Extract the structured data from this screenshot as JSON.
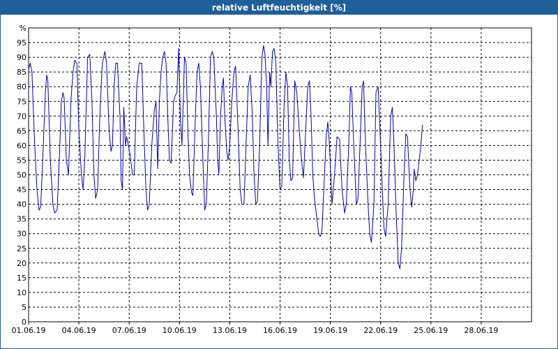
{
  "window": {
    "title": "relative Luftfeuchtigkeit [%]"
  },
  "chart_data": {
    "type": "line",
    "title": "relative Luftfeuchtigkeit [%]",
    "ylabel": "%",
    "xlabel": "",
    "ylim": [
      0,
      100
    ],
    "y_ticks": [
      0,
      5,
      10,
      15,
      20,
      25,
      30,
      35,
      40,
      45,
      50,
      55,
      60,
      65,
      70,
      75,
      80,
      85,
      90,
      95
    ],
    "x_tick_labels": [
      "01.06.19",
      "04.06.19",
      "07.06.19",
      "10.06.19",
      "13.06.19",
      "16.06.19",
      "19.06.19",
      "22.06.19",
      "25.06.19",
      "28.06.19"
    ],
    "xlim_days": [
      1,
      31
    ],
    "grid": true,
    "line_color": "#0000b8",
    "series": [
      {
        "points": [
          [
            1.0,
            86
          ],
          [
            1.1,
            88
          ],
          [
            1.2,
            85
          ],
          [
            1.35,
            62
          ],
          [
            1.5,
            45
          ],
          [
            1.62,
            38
          ],
          [
            1.72,
            39
          ],
          [
            1.88,
            60
          ],
          [
            2.0,
            78
          ],
          [
            2.08,
            84
          ],
          [
            2.15,
            82
          ],
          [
            2.3,
            55
          ],
          [
            2.45,
            40
          ],
          [
            2.55,
            37
          ],
          [
            2.7,
            38
          ],
          [
            2.85,
            58
          ],
          [
            2.95,
            75
          ],
          [
            3.05,
            78
          ],
          [
            3.12,
            76
          ],
          [
            3.25,
            55
          ],
          [
            3.38,
            50
          ],
          [
            3.52,
            75
          ],
          [
            3.65,
            85
          ],
          [
            3.75,
            89
          ],
          [
            3.88,
            88
          ],
          [
            4.0,
            65
          ],
          [
            4.15,
            50
          ],
          [
            4.25,
            45
          ],
          [
            4.35,
            55
          ],
          [
            4.52,
            90
          ],
          [
            4.65,
            91
          ],
          [
            4.78,
            75
          ],
          [
            4.9,
            50
          ],
          [
            5.0,
            42
          ],
          [
            5.12,
            45
          ],
          [
            5.25,
            70
          ],
          [
            5.4,
            88
          ],
          [
            5.55,
            92
          ],
          [
            5.65,
            88
          ],
          [
            5.8,
            65
          ],
          [
            5.92,
            58
          ],
          [
            6.0,
            60
          ],
          [
            6.1,
            80
          ],
          [
            6.2,
            88
          ],
          [
            6.3,
            88
          ],
          [
            6.45,
            70
          ],
          [
            6.52,
            48
          ],
          [
            6.6,
            45
          ],
          [
            6.68,
            73
          ],
          [
            6.78,
            60
          ],
          [
            6.85,
            63
          ],
          [
            6.95,
            60
          ],
          [
            7.05,
            57
          ],
          [
            7.2,
            50
          ],
          [
            7.3,
            50
          ],
          [
            7.45,
            80
          ],
          [
            7.6,
            88
          ],
          [
            7.75,
            88
          ],
          [
            7.88,
            65
          ],
          [
            8.0,
            45
          ],
          [
            8.1,
            38
          ],
          [
            8.2,
            40
          ],
          [
            8.35,
            60
          ],
          [
            8.5,
            72
          ],
          [
            8.6,
            75
          ],
          [
            8.7,
            52
          ],
          [
            8.8,
            75
          ],
          [
            8.9,
            85
          ],
          [
            9.0,
            90
          ],
          [
            9.1,
            92
          ],
          [
            9.2,
            88
          ],
          [
            9.3,
            70
          ],
          [
            9.4,
            55
          ],
          [
            9.5,
            54
          ],
          [
            9.65,
            75
          ],
          [
            9.75,
            77
          ],
          [
            9.85,
            78
          ],
          [
            9.95,
            93
          ],
          [
            10.05,
            70
          ],
          [
            10.15,
            60
          ],
          [
            10.3,
            90
          ],
          [
            10.4,
            88
          ],
          [
            10.5,
            65
          ],
          [
            10.6,
            50
          ],
          [
            10.72,
            44
          ],
          [
            10.8,
            43
          ],
          [
            10.95,
            70
          ],
          [
            11.05,
            85
          ],
          [
            11.15,
            88
          ],
          [
            11.25,
            80
          ],
          [
            11.4,
            55
          ],
          [
            11.5,
            38
          ],
          [
            11.6,
            40
          ],
          [
            11.72,
            60
          ],
          [
            11.85,
            90
          ],
          [
            11.95,
            92
          ],
          [
            12.05,
            90
          ],
          [
            12.2,
            70
          ],
          [
            12.28,
            55
          ],
          [
            12.35,
            50
          ],
          [
            12.45,
            70
          ],
          [
            12.55,
            80
          ],
          [
            12.62,
            83
          ],
          [
            12.7,
            70
          ],
          [
            12.82,
            58
          ],
          [
            12.9,
            55
          ],
          [
            13.0,
            60
          ],
          [
            13.12,
            75
          ],
          [
            13.25,
            85
          ],
          [
            13.35,
            87
          ],
          [
            13.5,
            65
          ],
          [
            13.62,
            45
          ],
          [
            13.72,
            40
          ],
          [
            13.85,
            40
          ],
          [
            13.97,
            60
          ],
          [
            14.1,
            80
          ],
          [
            14.22,
            84
          ],
          [
            14.35,
            70
          ],
          [
            14.45,
            50
          ],
          [
            14.55,
            40
          ],
          [
            14.65,
            41
          ],
          [
            14.78,
            60
          ],
          [
            14.92,
            90
          ],
          [
            15.02,
            94
          ],
          [
            15.1,
            91
          ],
          [
            15.2,
            80
          ],
          [
            15.28,
            60
          ],
          [
            15.38,
            85
          ],
          [
            15.45,
            80
          ],
          [
            15.55,
            92
          ],
          [
            15.65,
            93
          ],
          [
            15.75,
            88
          ],
          [
            15.88,
            60
          ],
          [
            16.0,
            45
          ],
          [
            16.1,
            46
          ],
          [
            16.25,
            75
          ],
          [
            16.35,
            85
          ],
          [
            16.45,
            80
          ],
          [
            16.55,
            55
          ],
          [
            16.65,
            48
          ],
          [
            16.75,
            49
          ],
          [
            16.88,
            82
          ],
          [
            17.0,
            78
          ],
          [
            17.15,
            65
          ],
          [
            17.28,
            55
          ],
          [
            17.4,
            49
          ],
          [
            17.55,
            68
          ],
          [
            17.65,
            80
          ],
          [
            17.75,
            82
          ],
          [
            17.85,
            70
          ],
          [
            17.95,
            50
          ],
          [
            18.05,
            42
          ],
          [
            18.2,
            35
          ],
          [
            18.3,
            30
          ],
          [
            18.4,
            29
          ],
          [
            18.5,
            31
          ],
          [
            18.65,
            50
          ],
          [
            18.75,
            63
          ],
          [
            18.85,
            68
          ],
          [
            18.95,
            60
          ],
          [
            19.1,
            40
          ],
          [
            19.25,
            50
          ],
          [
            19.4,
            63
          ],
          [
            19.55,
            62
          ],
          [
            19.7,
            45
          ],
          [
            19.85,
            37
          ],
          [
            19.95,
            40
          ],
          [
            20.1,
            60
          ],
          [
            20.2,
            80
          ],
          [
            20.28,
            78
          ],
          [
            20.4,
            60
          ],
          [
            20.55,
            40
          ],
          [
            20.65,
            42
          ],
          [
            20.8,
            65
          ],
          [
            20.9,
            80
          ],
          [
            20.98,
            82
          ],
          [
            21.1,
            60
          ],
          [
            21.25,
            40
          ],
          [
            21.35,
            30
          ],
          [
            21.45,
            27
          ],
          [
            21.6,
            40
          ],
          [
            21.72,
            78
          ],
          [
            21.85,
            80
          ],
          [
            22.0,
            60
          ],
          [
            22.1,
            45
          ],
          [
            22.2,
            32
          ],
          [
            22.3,
            29
          ],
          [
            22.45,
            40
          ],
          [
            22.6,
            70
          ],
          [
            22.7,
            73
          ],
          [
            22.8,
            60
          ],
          [
            22.92,
            38
          ],
          [
            23.05,
            20
          ],
          [
            23.15,
            18
          ],
          [
            23.25,
            25
          ],
          [
            23.4,
            50
          ],
          [
            23.5,
            64
          ],
          [
            23.6,
            63
          ],
          [
            23.75,
            45
          ],
          [
            23.85,
            39
          ],
          [
            23.95,
            45
          ],
          [
            24.0,
            52
          ],
          [
            24.1,
            48
          ],
          [
            24.2,
            50
          ],
          [
            24.3,
            55
          ],
          [
            24.4,
            60
          ],
          [
            24.5,
            67
          ]
        ]
      }
    ]
  }
}
